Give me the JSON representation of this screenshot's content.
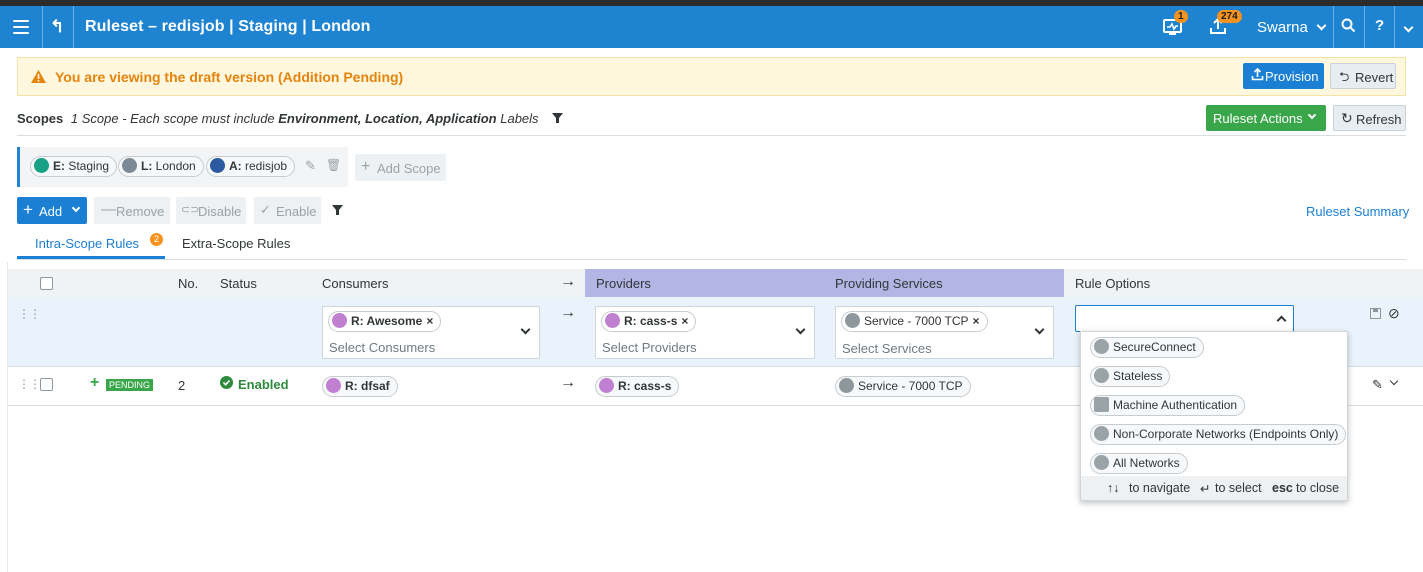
{
  "header": {
    "title": "Ruleset  –  redisjob | Staging | London",
    "alerts_badge": "1",
    "provision_badge": "274",
    "user": "Swarna",
    "help": "?"
  },
  "draft_banner": {
    "message": "You are viewing the draft version (Addition Pending)",
    "provision_label": "Provision",
    "revert_label": "Revert"
  },
  "scopes": {
    "label": "Scopes",
    "desc_prefix": "1 Scope - Each scope must include ",
    "desc_bold": "Environment, Location, Application",
    "desc_suffix": " Labels",
    "ruleset_actions_label": "Ruleset Actions",
    "refresh_label": "Refresh",
    "labels": [
      {
        "prefix": "E:",
        "value": "Staging",
        "color": "#16a085"
      },
      {
        "prefix": "L:",
        "value": "London",
        "color": "#7b8a94"
      },
      {
        "prefix": "A:",
        "value": "redisjob",
        "color": "#2c5aa0"
      }
    ],
    "add_scope_label": "Add Scope"
  },
  "toolbar": {
    "add_label": "Add",
    "remove_label": "Remove",
    "disable_label": "Disable",
    "enable_label": "Enable",
    "summary_link": "Ruleset Summary"
  },
  "tabs": {
    "intra_label": "Intra-Scope Rules",
    "intra_count": "2",
    "extra_label": "Extra-Scope Rules"
  },
  "table": {
    "headers": {
      "no": "No.",
      "status": "Status",
      "consumers": "Consumers",
      "arrow": "→",
      "providers": "Providers",
      "services": "Providing Services",
      "options": "Rule Options"
    },
    "edit_row": {
      "consumer_chip": "R: Awesome",
      "consumer_placeholder": "Select Consumers",
      "provider_chip": "R: cass-s",
      "provider_placeholder": "Select Providers",
      "service_chip": "Service - 7000 TCP",
      "service_placeholder": "Select Services"
    },
    "rows": [
      {
        "pending": "PENDING",
        "no": "2",
        "status": "Enabled",
        "consumer": "R: dfsaf",
        "provider": "R: cass-s",
        "service": "Service - 7000 TCP"
      }
    ]
  },
  "rule_options_dropdown": {
    "options": [
      "SecureConnect",
      "Stateless",
      "Machine Authentication",
      "Non-Corporate Networks (Endpoints Only)",
      "All Networks"
    ],
    "footer_nav": "to navigate",
    "footer_select": "to select",
    "footer_esc": "esc",
    "footer_close": "to close"
  },
  "colors": {
    "header": "#1e84d2",
    "warning": "#e6830b",
    "enabled": "#2e8b3e",
    "pending": "#3aa64a",
    "provider_header": "#b3b6e4",
    "role_icon": "#c07fd0"
  }
}
